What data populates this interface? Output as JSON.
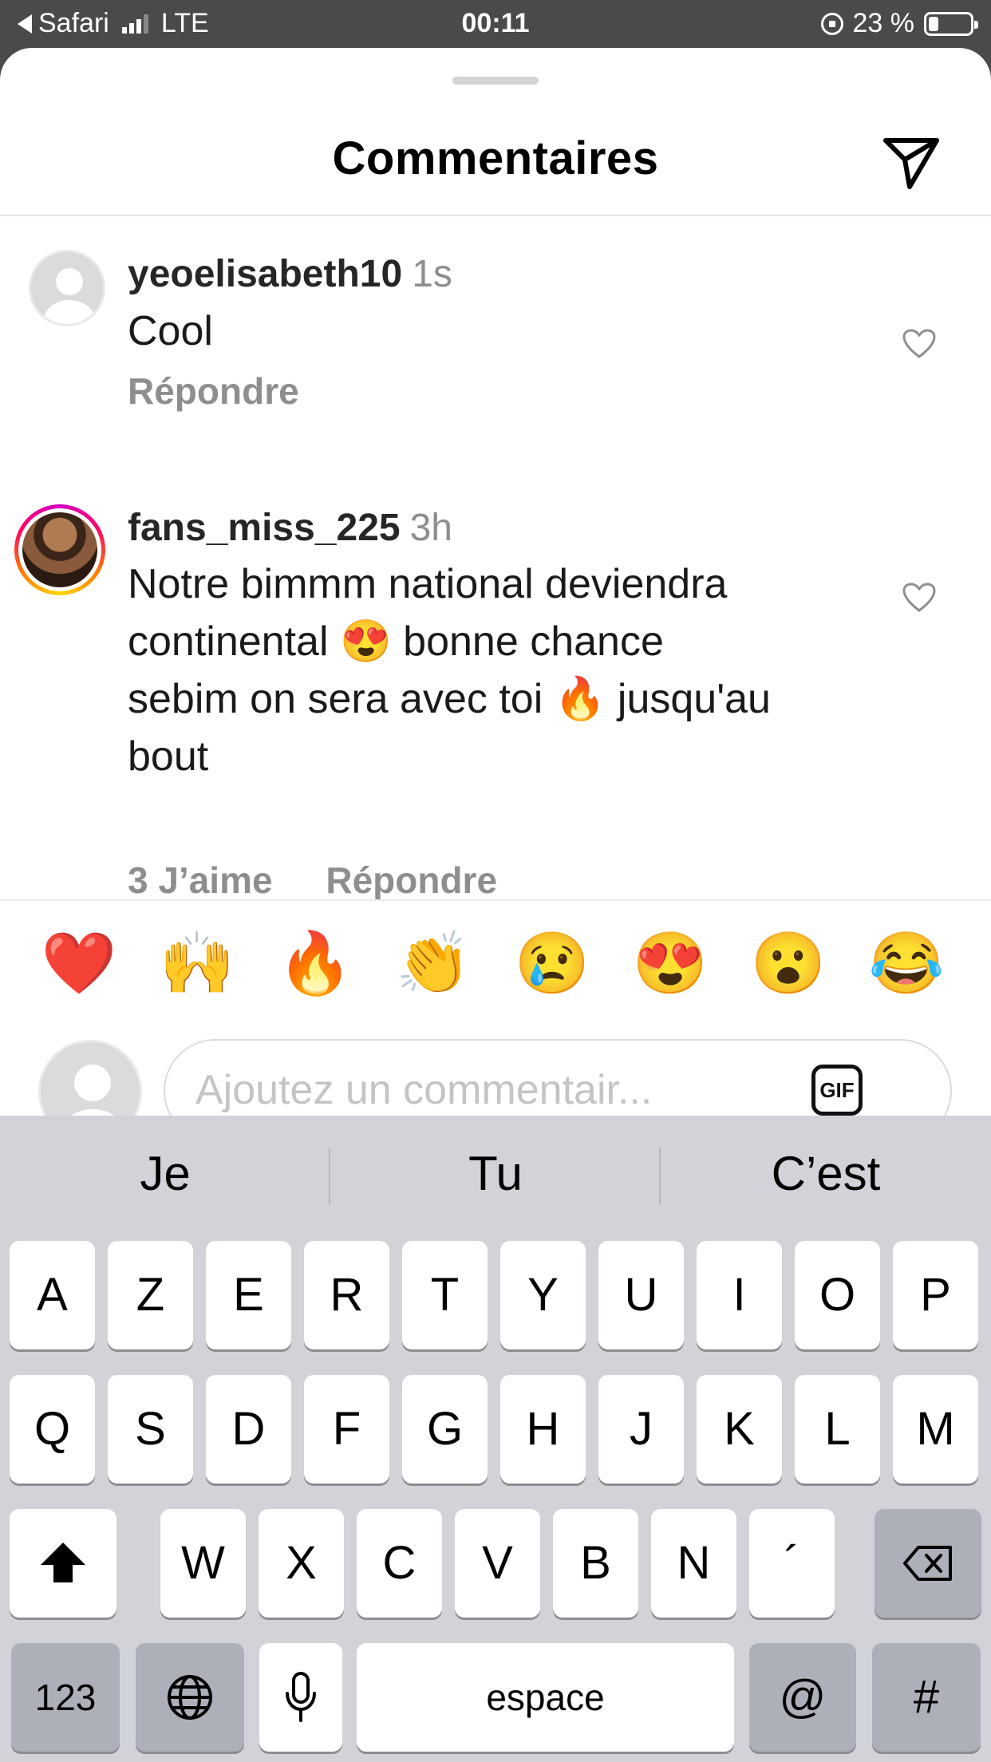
{
  "status_bar": {
    "back_app": "Safari",
    "network": "LTE",
    "time": "00:11",
    "battery_text": "23 %",
    "battery_level": 0.23
  },
  "sheet": {
    "title": "Commentaires"
  },
  "comments": [
    {
      "username": "yeoelisabeth10",
      "time": "1s",
      "lines": [
        "Cool"
      ],
      "likes": "",
      "reply_label": "Répondre"
    },
    {
      "username": "fans_miss_225",
      "time": "3h",
      "lines": [
        "Notre bimmm national deviendra",
        "continental 😍 bonne chance",
        "sebim on sera avec toi 🔥 jusqu'au",
        "bout"
      ],
      "likes": "3 J’aime",
      "reply_label": "Répondre"
    }
  ],
  "emoji_bar": [
    "❤️",
    "🙌",
    "🔥",
    "👏",
    "😢",
    "😍",
    "😮",
    "😂"
  ],
  "composer": {
    "placeholder": "Ajoutez un commentair...",
    "gif_label": "GIF"
  },
  "keyboard": {
    "suggestions": [
      "Je",
      "Tu",
      "C’est"
    ],
    "row1": [
      "A",
      "Z",
      "E",
      "R",
      "T",
      "Y",
      "U",
      "I",
      "O",
      "P"
    ],
    "row2": [
      "Q",
      "S",
      "D",
      "F",
      "G",
      "H",
      "J",
      "K",
      "L",
      "M"
    ],
    "row3": [
      "W",
      "X",
      "C",
      "V",
      "B",
      "N",
      "´"
    ],
    "numbers_label": "123",
    "space_label": "espace",
    "at_label": "@",
    "hash_label": "#"
  }
}
